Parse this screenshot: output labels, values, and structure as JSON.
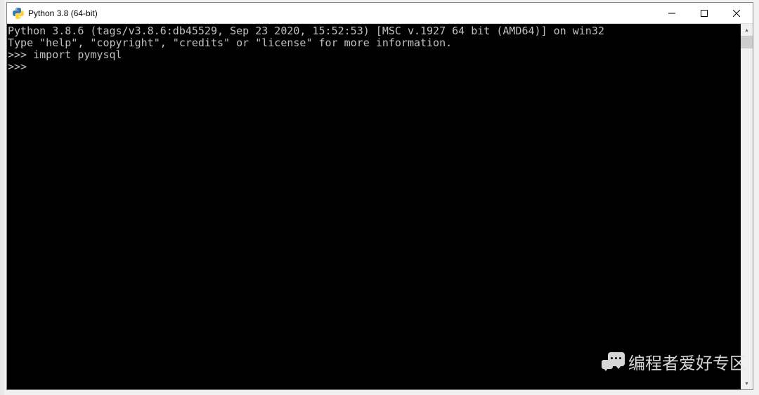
{
  "window": {
    "title": "Python 3.8 (64-bit)"
  },
  "console": {
    "lines": [
      "Python 3.8.6 (tags/v3.8.6:db45529, Sep 23 2020, 15:52:53) [MSC v.1927 64 bit (AMD64)] on win32",
      "Type \"help\", \"copyright\", \"credits\" or \"license\" for more information.",
      ">>> import pymysql",
      ">>> "
    ]
  },
  "watermark": {
    "text": "编程者爱好专区"
  }
}
